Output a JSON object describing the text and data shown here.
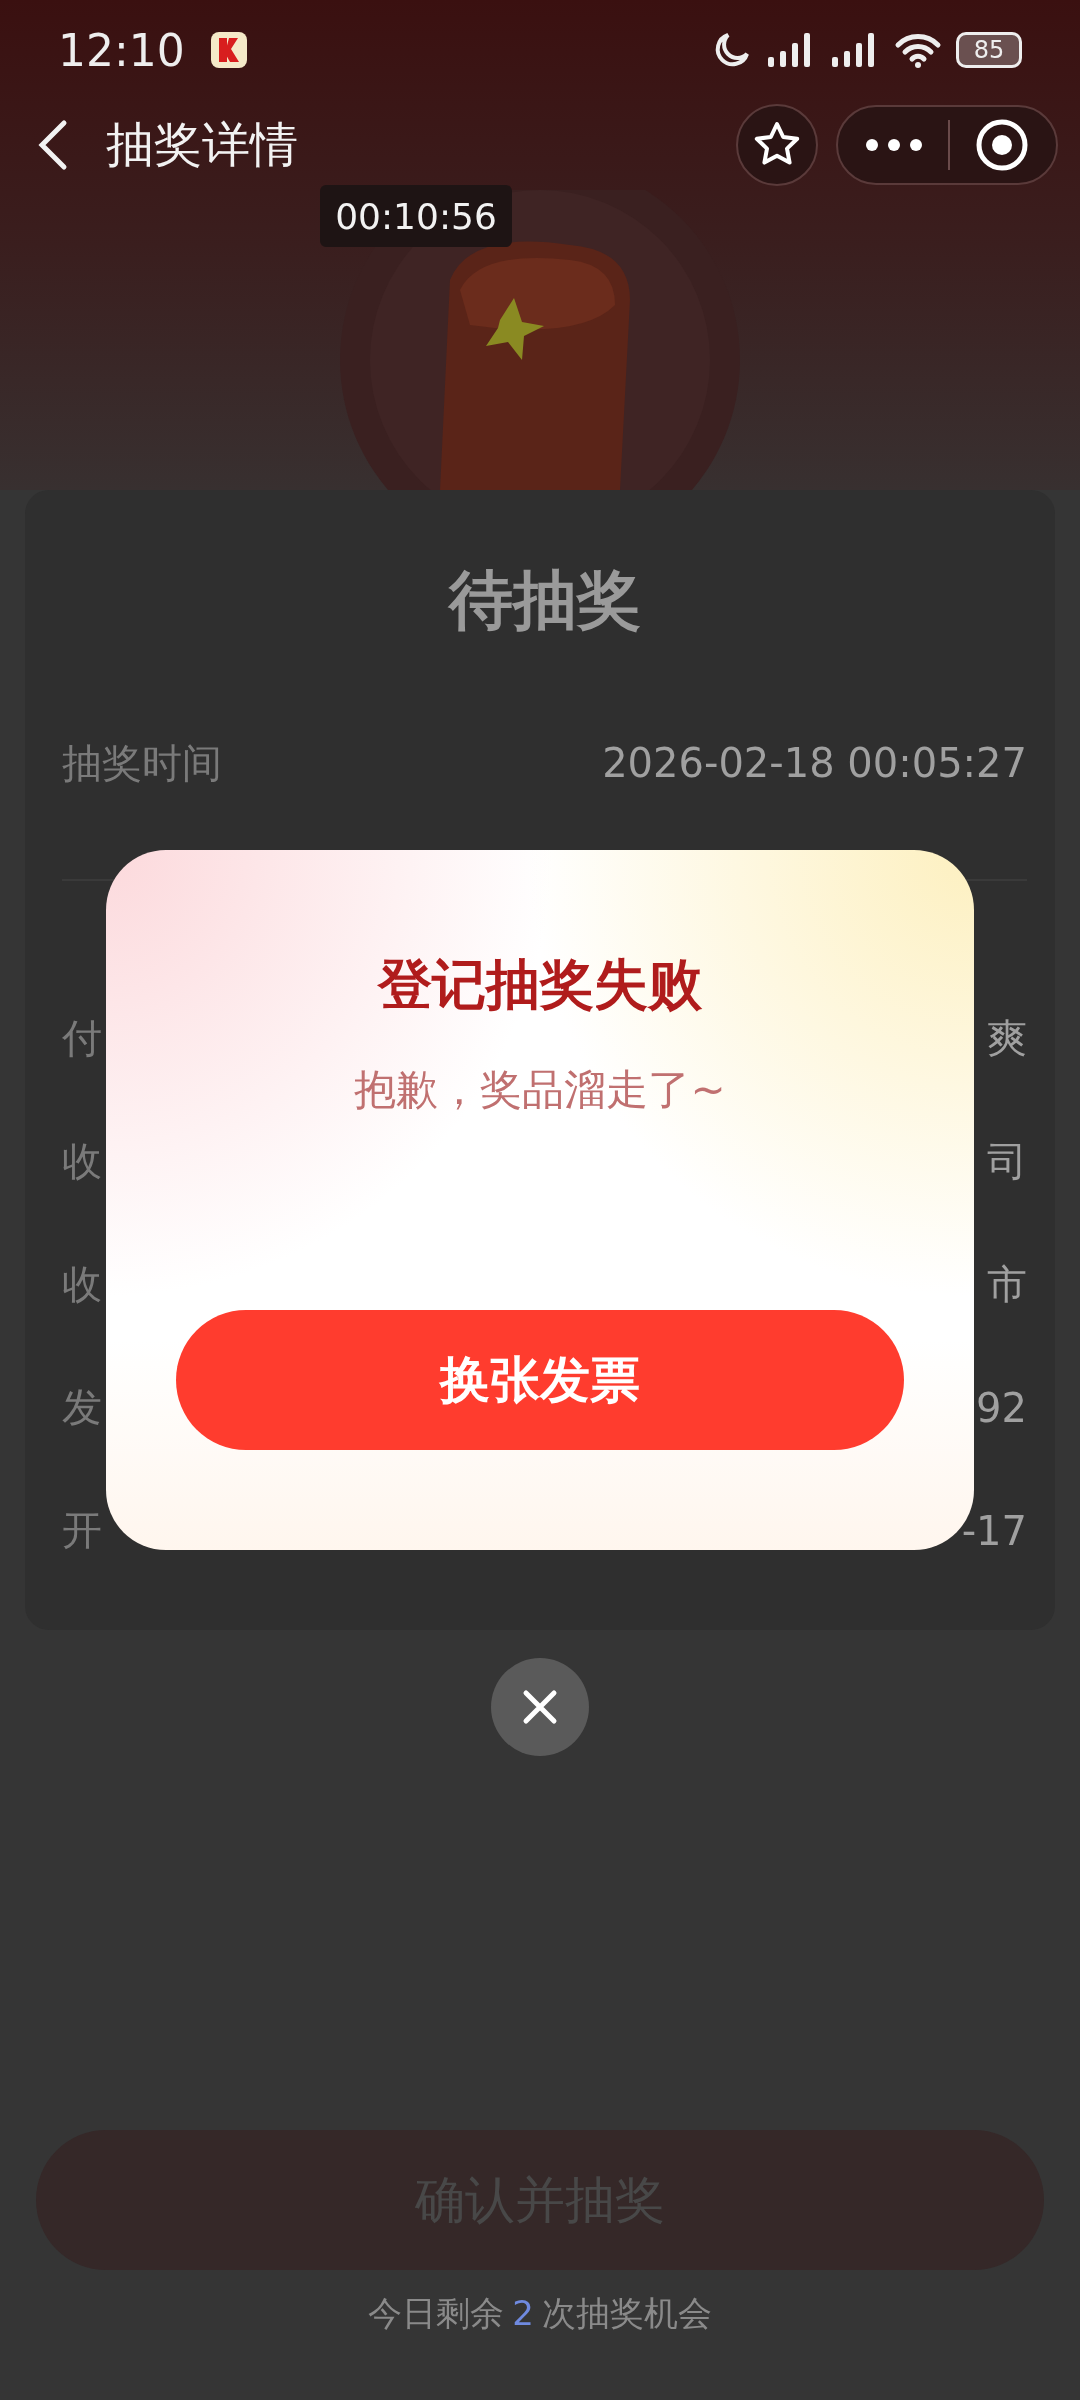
{
  "status_bar": {
    "time": "12:10",
    "battery": "85"
  },
  "nav": {
    "title": "抽奖详情"
  },
  "timer": "00:10:56",
  "card": {
    "status": "待抽奖",
    "rows": [
      {
        "label": "抽奖时间",
        "value": "2026-02-18 00:05:27"
      },
      {
        "label": "付",
        "value": "爽"
      },
      {
        "label": "收",
        "value": "司"
      },
      {
        "label": "收",
        "value": "市"
      },
      {
        "label": "发",
        "value": "92"
      },
      {
        "label": "开",
        "value": "-17"
      }
    ]
  },
  "draw_button": {
    "label": "确认并抽奖"
  },
  "remaining": {
    "prefix": "今日剩余",
    "count": "2",
    "suffix": "次抽奖机会"
  },
  "dialog": {
    "title": "登记抽奖失败",
    "message": "抱歉，奖品溜走了~",
    "button": "换张发票"
  }
}
